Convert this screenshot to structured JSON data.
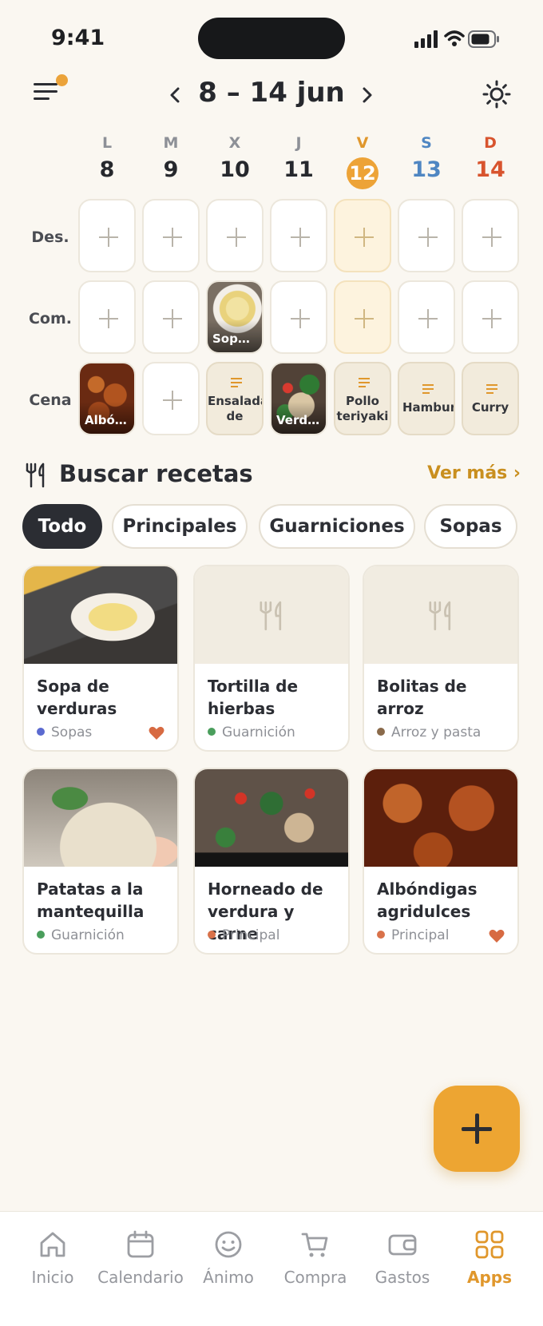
{
  "status": {
    "time": "9:41"
  },
  "header": {
    "week_title": "8 – 14 jun"
  },
  "days": [
    {
      "letter": "L",
      "num": "8"
    },
    {
      "letter": "M",
      "num": "9"
    },
    {
      "letter": "X",
      "num": "10"
    },
    {
      "letter": "J",
      "num": "11"
    },
    {
      "letter": "V",
      "num": "12"
    },
    {
      "letter": "S",
      "num": "13"
    },
    {
      "letter": "D",
      "num": "14"
    }
  ],
  "meals": {
    "breakfast_label": "Des.",
    "lunch_label": "Com.",
    "dinner_label": "Cena",
    "lunch_wed": "Sopa ...",
    "dinner_mon": "Albón...",
    "dinner_wed": "Ensalada de",
    "dinner_thu": "Verdu...",
    "dinner_fri": "Pollo teriyaki",
    "dinner_sat": "Hamburg",
    "dinner_sun": "Curry"
  },
  "recipes_section": {
    "title": "Buscar recetas",
    "see_more": "Ver más ›"
  },
  "filters": [
    "Todo",
    "Principales",
    "Guarniciones",
    "Sopas"
  ],
  "recipes": [
    {
      "name": "Sopa de verduras",
      "category": "Sopas",
      "dot": "#5b6ad0",
      "fav": true
    },
    {
      "name": "Tortilla de hierbas",
      "category": "Guarnición",
      "dot": "#4a9e5c",
      "fav": false
    },
    {
      "name": "Bolitas de arroz",
      "category": "Arroz y pasta",
      "dot": "#8a6a4a",
      "fav": false
    },
    {
      "name": "Patatas a la mantequilla",
      "category": "Guarnición",
      "dot": "#4a9e5c",
      "fav": false
    },
    {
      "name": "Horneado de verdura y carne",
      "category": "Principal",
      "dot": "#d9724a",
      "fav": false
    },
    {
      "name": "Albóndigas agridulces",
      "category": "Principal",
      "dot": "#d9724a",
      "fav": true
    }
  ],
  "tabs": [
    "Inicio",
    "Calendario",
    "Ánimo",
    "Compra",
    "Gastos",
    "Apps"
  ],
  "colors": {
    "accent": "#eda337",
    "dark": "#2b2d33",
    "background": "#faf7f1",
    "heart": "#d76a42"
  }
}
